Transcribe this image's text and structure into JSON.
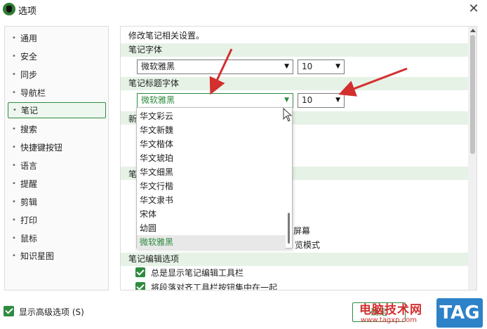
{
  "window": {
    "title": "选项"
  },
  "sidebar": {
    "items": [
      {
        "label": "通用"
      },
      {
        "label": "安全"
      },
      {
        "label": "同步"
      },
      {
        "label": "导航栏"
      },
      {
        "label": "笔记"
      },
      {
        "label": "搜索"
      },
      {
        "label": "快捷键按钮"
      },
      {
        "label": "语言"
      },
      {
        "label": "提醒"
      },
      {
        "label": "剪辑"
      },
      {
        "label": "打印"
      },
      {
        "label": "鼠标"
      },
      {
        "label": "知识星图"
      }
    ],
    "selected_index": 4
  },
  "content": {
    "intro": "修改笔记相关设置。",
    "note_font": {
      "header": "笔记字体",
      "font": "微软雅黑",
      "size": "10"
    },
    "title_font": {
      "header": "笔记标题字体",
      "font": "微软雅黑",
      "size": "10"
    },
    "partial_labels": {
      "a": "新",
      "b": "笔",
      "c": "屏幕",
      "d": "览模式"
    },
    "edit_options": {
      "header": "笔记编辑选项",
      "checks": [
        "总是显示笔记编辑工具栏",
        "将段落对齐工具栏按钮集中在一起"
      ]
    }
  },
  "dropdown": {
    "options": [
      "华文彩云",
      "华文新魏",
      "华文楷体",
      "华文琥珀",
      "华文细黑",
      "华文行楷",
      "华文隶书",
      "宋体",
      "幼圆",
      "微软雅黑"
    ],
    "selected": "微软雅黑"
  },
  "footer": {
    "advanced_label": "显示高级选项 (S)",
    "ok_label": "确定"
  },
  "watermark": {
    "text": "电脑技术网",
    "url": "www.tagxp.com",
    "tag": "TAG"
  },
  "colors": {
    "accent": "#2e8b3f",
    "section_bg": "#e6f2e6",
    "arrow": "#d32f2f"
  }
}
